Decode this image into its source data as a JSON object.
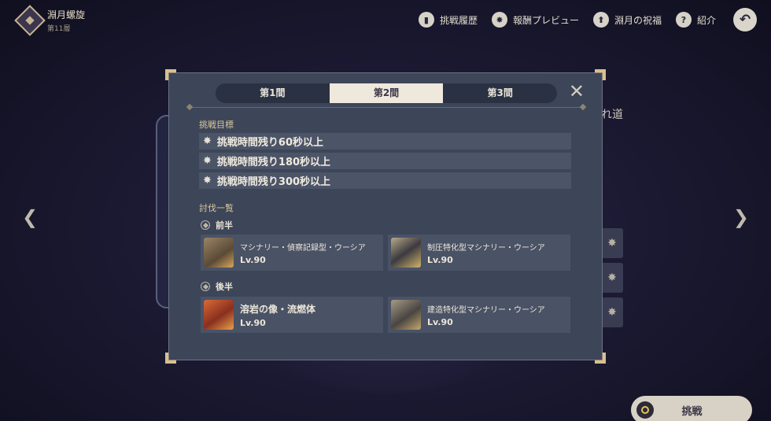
{
  "header": {
    "title": "淵月螺旋",
    "subtitle": "第11層",
    "nav": [
      {
        "label": "挑戦履歴",
        "icon": "book-icon",
        "glyph": "▮"
      },
      {
        "label": "報酬プレビュー",
        "icon": "reward-icon",
        "glyph": "✸"
      },
      {
        "label": "淵月の祝福",
        "icon": "blessing-icon",
        "glyph": "⬆"
      },
      {
        "label": "紹介",
        "icon": "help-icon",
        "glyph": "?"
      }
    ],
    "back_glyph": "↶"
  },
  "background": {
    "side_text": "れ道",
    "challenge_button": "挑戦"
  },
  "modal": {
    "tabs": [
      "第1間",
      "第2間",
      "第3間"
    ],
    "active_tab": 1,
    "close_glyph": "✕",
    "goals_title": "挑戦目標",
    "goals": [
      "挑戦時間残り60秒以上",
      "挑戦時間残り180秒以上",
      "挑戦時間残り300秒以上"
    ],
    "enemies_title": "討伐一覧",
    "first_half": {
      "label": "前半",
      "enemies": [
        {
          "name": "マシナリー・偵察記録型・ウーシア",
          "level": "Lv.90"
        },
        {
          "name": "制圧特化型マシナリー・ウーシア",
          "level": "Lv.90"
        }
      ]
    },
    "second_half": {
      "label": "後半",
      "enemies": [
        {
          "name": "溶岩の像・流燃体",
          "level": "Lv.90"
        },
        {
          "name": "建造特化型マシナリー・ウーシア",
          "level": "Lv.90"
        }
      ]
    }
  },
  "colors": {
    "accent_gold": "#d9c08a",
    "modal_bg": "#3d4558",
    "active_tab_bg": "#efe8dc"
  }
}
